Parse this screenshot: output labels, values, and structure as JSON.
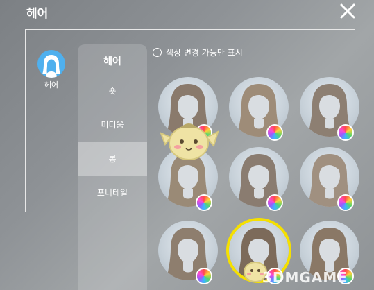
{
  "header": {
    "title": "헤어",
    "close_icon": "close-icon"
  },
  "category": {
    "label": "헤어",
    "icon": "hair-avatar-icon",
    "color": "#4fb0ee"
  },
  "subcategories": {
    "title": "헤어",
    "items": [
      {
        "label": "숏",
        "active": false
      },
      {
        "label": "미디움",
        "active": false
      },
      {
        "label": "롱",
        "active": true
      },
      {
        "label": "포니테일",
        "active": false
      }
    ]
  },
  "filter": {
    "label": "색상 변경 가능만 표시",
    "checked": false
  },
  "hairstyles": [
    {
      "id": "long-wavy-1",
      "color": "#8a7a6c",
      "selected": false
    },
    {
      "id": "long-wavy-2",
      "color": "#9e8c78",
      "selected": false
    },
    {
      "id": "long-curly-1",
      "color": "#8d7f72",
      "selected": false
    },
    {
      "id": "long-curly-2",
      "color": "#9a8a76",
      "selected": false
    },
    {
      "id": "pigtails",
      "color": "#8a7c70",
      "selected": false
    },
    {
      "id": "twin-tails",
      "color": "#a09080",
      "selected": false
    },
    {
      "id": "braided",
      "color": "#8e7e6e",
      "selected": false
    },
    {
      "id": "long-straight",
      "color": "#7c6a5a",
      "selected": true
    },
    {
      "id": "long-curly-3",
      "color": "#8a7866",
      "selected": false
    }
  ],
  "watermark": "3DMGAME",
  "selection_color": "#f5e000"
}
